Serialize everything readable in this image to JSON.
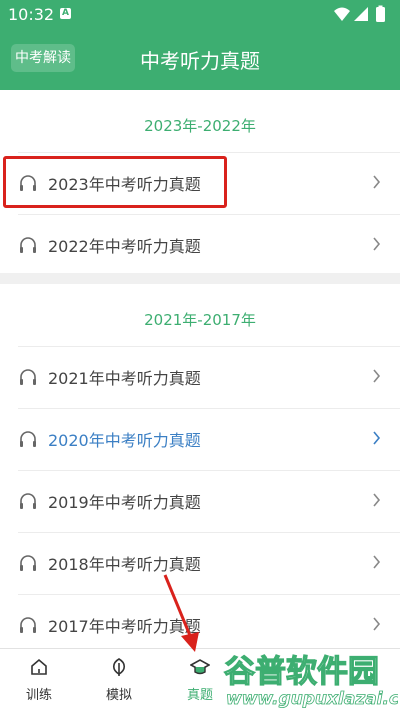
{
  "status": {
    "time": "10:32",
    "notification_icon": "A"
  },
  "appbar": {
    "back_label": "中考解读",
    "title": "中考听力真题"
  },
  "sections": [
    {
      "heading": "2023年-2022年",
      "items": [
        {
          "label": "2023年中考听力真题"
        },
        {
          "label": "2022年中考听力真题"
        }
      ]
    },
    {
      "heading": "2021年-2017年",
      "items": [
        {
          "label": "2021年中考听力真题"
        },
        {
          "label": "2020年中考听力真题",
          "active": true
        },
        {
          "label": "2019年中考听力真题"
        },
        {
          "label": "2018年中考听力真题"
        },
        {
          "label": "2017年中考听力真题"
        }
      ]
    }
  ],
  "tabs": [
    {
      "label": "训练",
      "icon": "home-icon"
    },
    {
      "label": "模拟",
      "icon": "leaf-icon"
    },
    {
      "label": "真题",
      "icon": "graduation-cap-icon",
      "active": true
    }
  ],
  "watermark": {
    "brand": "谷普软件园",
    "url": "www.gupuxlazai.com"
  },
  "colors": {
    "accent": "#3dae71",
    "highlight": "#d9221c",
    "active_item": "#3b7fc4"
  }
}
